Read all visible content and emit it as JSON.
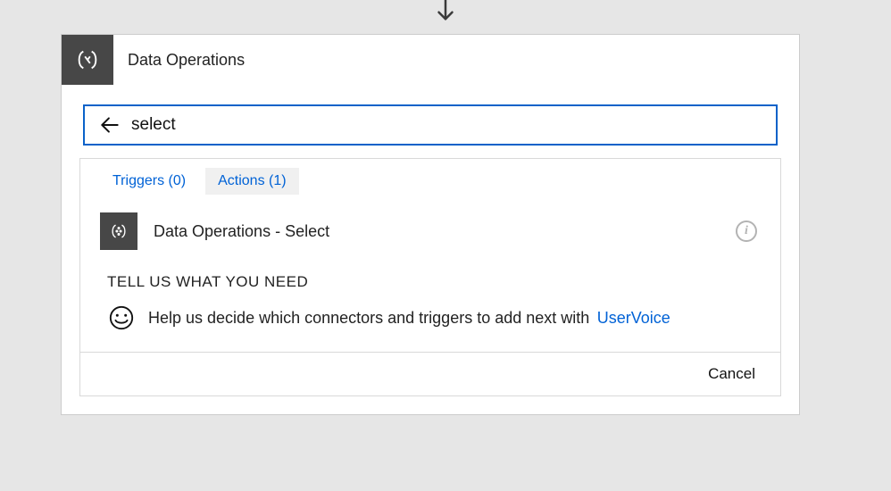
{
  "header": {
    "title": "Data Operations"
  },
  "search": {
    "value": "select"
  },
  "tabs": {
    "triggers": "Triggers (0)",
    "actions": "Actions (1)"
  },
  "result": {
    "title": "Data Operations - Select"
  },
  "feedback": {
    "heading": "TELL US WHAT YOU NEED",
    "text": "Help us decide which connectors and triggers to add next with",
    "link": "UserVoice"
  },
  "footer": {
    "cancel": "Cancel"
  }
}
